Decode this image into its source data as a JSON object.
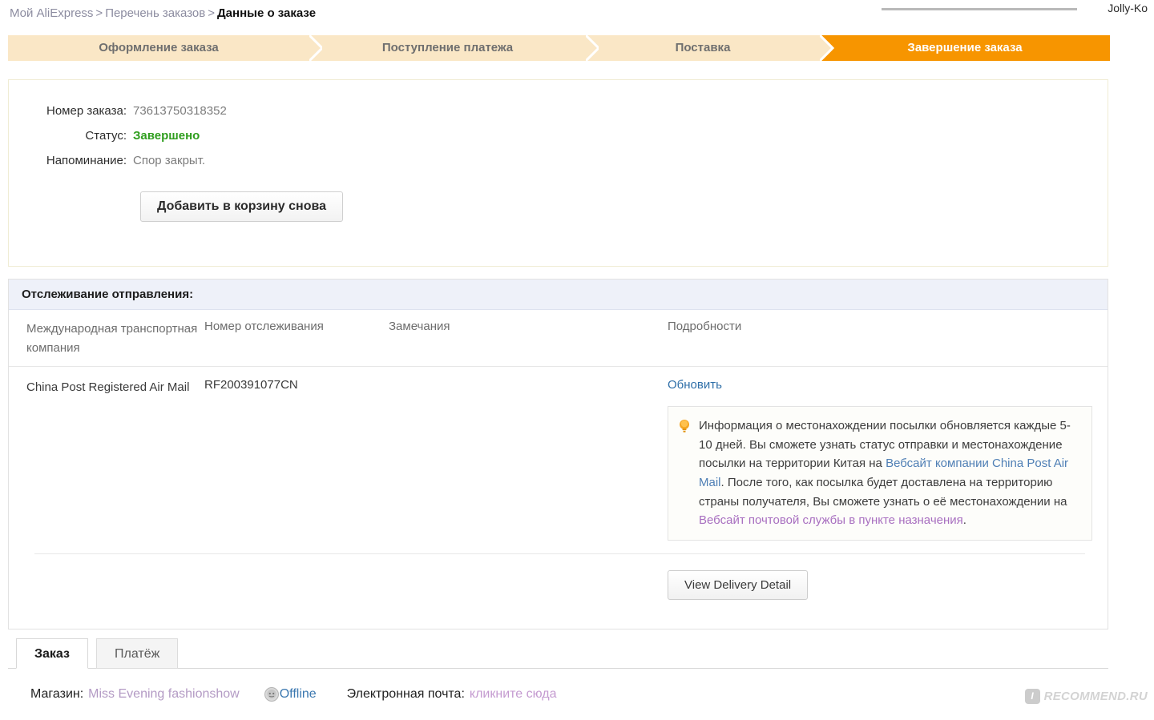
{
  "header": {
    "breadcrumb": [
      {
        "label": "Мой AliExpress",
        "current": false
      },
      {
        "label": "Перечень заказов",
        "current": false
      },
      {
        "label": "Данные о заказе",
        "current": true
      }
    ],
    "separator": ">",
    "user_name": "Jolly-Ko"
  },
  "steps": [
    {
      "label": "Оформление заказа",
      "active": false
    },
    {
      "label": "Поступление платежа",
      "active": false
    },
    {
      "label": "Поставка",
      "active": false
    },
    {
      "label": "Завершение заказа",
      "active": true
    }
  ],
  "order_panel": {
    "order_number_label": "Номер заказа:",
    "order_number_value": "73613750318352",
    "status_label": "Статус:",
    "status_value": "Завершено",
    "reminder_label": "Напоминание:",
    "reminder_value": "Спор закрыт.",
    "readd_button": "Добавить в корзину снова"
  },
  "tracking": {
    "section_title": "Отслеживание отправления:",
    "columns": [
      "Международная транспортная компания",
      "Номер отслеживания",
      "Замечания",
      "Подробности"
    ],
    "row": {
      "carrier": "China Post Registered Air Mail",
      "tracking_number": "RF200391077CN",
      "notes": "",
      "refresh_link": "Обновить"
    },
    "info_box": {
      "text_part_1": "Информация о местонахождении посылки обновляется каждые 5-10 дней. Вы сможете узнать статус отправки и местонахождение посылки на территории Китая на ",
      "link_1": "Вебсайт компании China Post Air Mail",
      "text_part_2": ". После того, как посылка будет доставлена на территорию страны получателя, Вы сможете узнать о её местонахождении на ",
      "link_2": "Вебсайт почтовой службы в пункте назначения",
      "text_part_3": "."
    },
    "delivery_button": "View Delivery Detail"
  },
  "tabs": [
    {
      "label": "Заказ",
      "active": true
    },
    {
      "label": "Платёж",
      "active": false
    }
  ],
  "shop_row": {
    "shop_label": "Магазин:",
    "shop_name": "Miss Evening fashionshow",
    "presence_status": "Offline",
    "email_label": "Электронная почта:",
    "email_link": "кликните сюда"
  },
  "watermark": {
    "badge": "I",
    "text": "RECOMMEND.RU"
  },
  "colors": {
    "accent_orange": "#f79500",
    "step_inactive": "#fae7c6",
    "status_green": "#2f9e1e",
    "link_blue": "#2f6fa8",
    "link_purple": "#a86fc0",
    "tracking_header_bg": "#eef1f9"
  }
}
